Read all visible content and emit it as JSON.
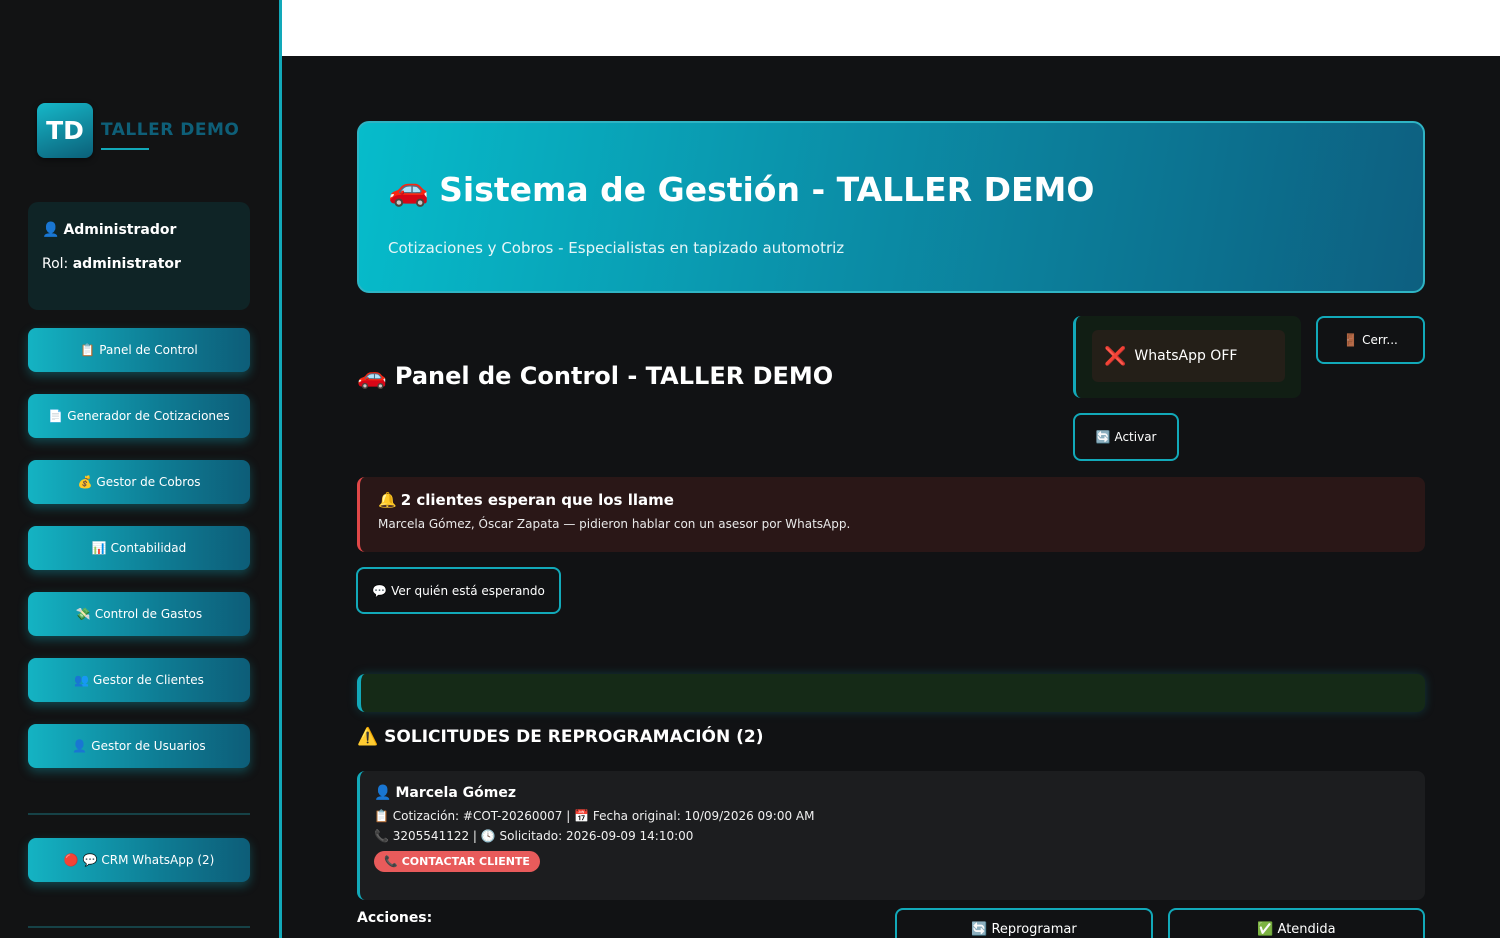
{
  "logo": {
    "initials": "TD",
    "name": "TALLER DEMO"
  },
  "user": {
    "name": "Administrador",
    "role_label": "Rol:",
    "role": "administrator"
  },
  "nav": [
    {
      "icon": "📋",
      "label": "Panel de Control"
    },
    {
      "icon": "📄",
      "label": "Generador de Cotizaciones"
    },
    {
      "icon": "💰",
      "label": "Gestor de Cobros"
    },
    {
      "icon": "📊",
      "label": "Contabilidad"
    },
    {
      "icon": "💸",
      "label": "Control de Gastos"
    },
    {
      "icon": "👥",
      "label": "Gestor de Clientes"
    },
    {
      "icon": "👤",
      "label": "Gestor de Usuarios"
    }
  ],
  "crm": {
    "icon": "🔴 💬",
    "label": "CRM WhatsApp (2)"
  },
  "hero": {
    "icon": "🚗",
    "title": "Sistema de Gestión - TALLER DEMO",
    "subtitle": "Cotizaciones y Cobros - Especialistas en tapizado automotriz"
  },
  "panel": {
    "icon": "🚗",
    "title": "Panel de Control - TALLER DEMO"
  },
  "whatsapp": {
    "icon": "❌",
    "status": "WhatsApp OFF",
    "activate_icon": "🔄",
    "activate_label": "Activar"
  },
  "logout": {
    "icon": "🚪",
    "label": "Cerr..."
  },
  "alert": {
    "icon": "🔔",
    "title": "2 clientes esperan que los llame",
    "body": "Marcela Gómez, Óscar Zapata — pidieron hablar con un asesor por WhatsApp."
  },
  "waiting_button": {
    "icon": "💬",
    "label": "Ver quién está esperando"
  },
  "section": {
    "icon": "⚠️",
    "title": "SOLICITUDES DE REPROGRAMACIÓN (2)"
  },
  "request": {
    "icon": "👤",
    "name": "Marcela Gómez",
    "line1": "📋 Cotización: #COT-20260007 | 📅 Fecha original: 10/09/2026 09:00 AM",
    "line2": "📞 3205541122 | 🕓 Solicitado: 2026-09-09 14:10:00",
    "contact_icon": "📞",
    "contact_label": "CONTACTAR CLIENTE"
  },
  "actions": {
    "label": "Acciones:",
    "reschedule_icon": "🔄",
    "reschedule_label": "Reprogramar",
    "done_icon": "✅",
    "done_label": "Atendida"
  },
  "colors": {
    "accent": "#12a9b9",
    "danger": "#e04848",
    "background": "#111214"
  }
}
